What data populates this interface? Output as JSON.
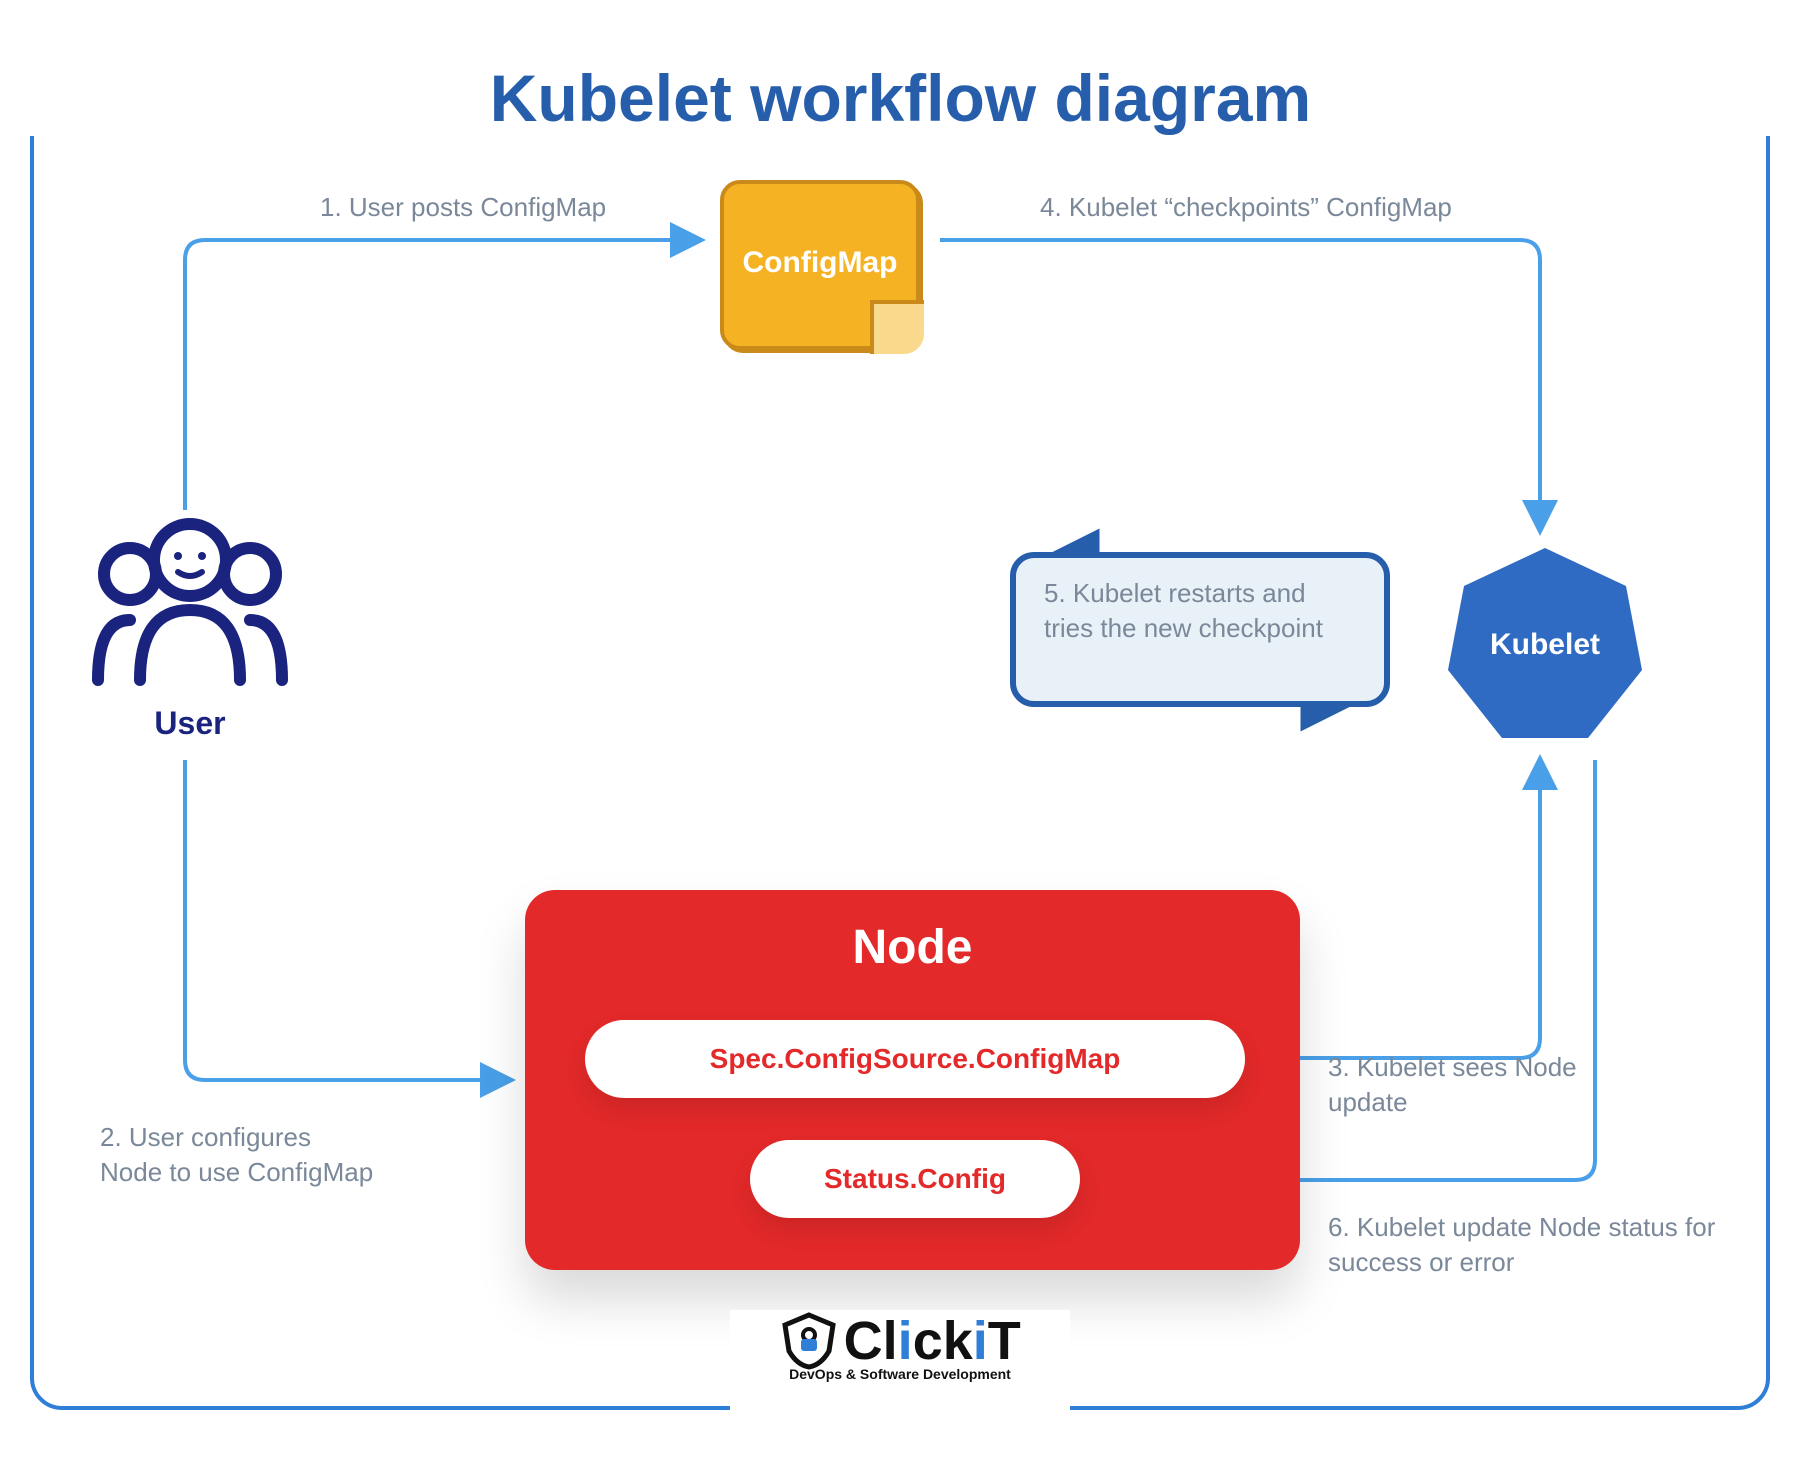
{
  "title": "Kubelet workflow diagram",
  "user": {
    "label": "User"
  },
  "configmap": {
    "label": "ConfigMap"
  },
  "steps": {
    "s1": "1. User posts ConfigMap",
    "s2": "2. User configures\nNode to use ConfigMap",
    "s3": "3. Kubelet sees\nNode update",
    "s4": "4. Kubelet “checkpoints” ConfigMap",
    "s5": "5. Kubelet restarts and tries the new checkpoint",
    "s6": "6. Kubelet update Node status for success or error"
  },
  "kubelet": {
    "label": "Kubelet"
  },
  "node": {
    "label": "Node",
    "pill1": "Spec.ConfigSource.ConfigMap",
    "pill2": "Status.Config"
  },
  "logo": {
    "name": "ClickiT",
    "tagline": "DevOps & Software Development"
  }
}
